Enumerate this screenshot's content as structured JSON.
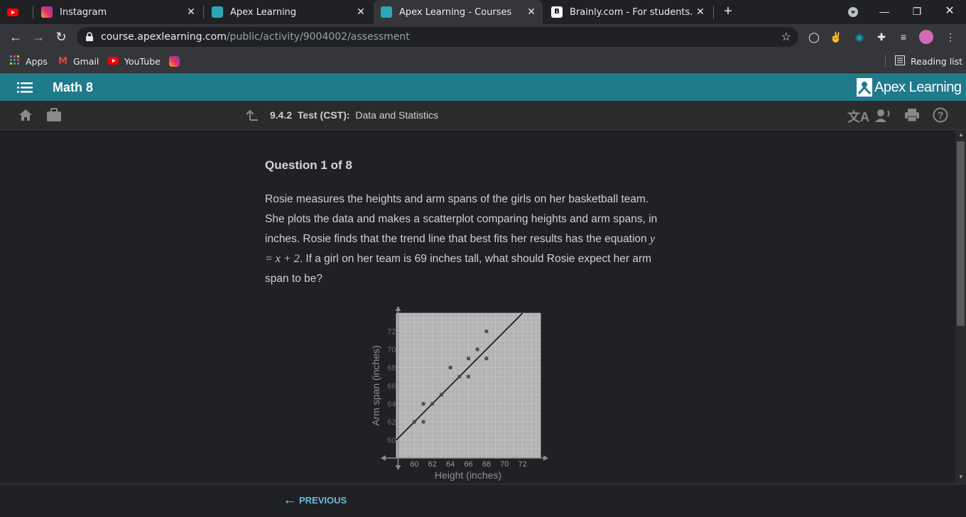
{
  "browser": {
    "tabs": [
      {
        "label": "",
        "favicon": "youtube-icon",
        "color": "#ff0000"
      },
      {
        "label": "Instagram",
        "favicon": "instagram-icon",
        "color": "#e1306c"
      },
      {
        "label": "Apex Learning",
        "favicon": "apex-learning-icon",
        "color": "#2aa6b8"
      },
      {
        "label": "Apex Learning - Courses",
        "favicon": "apex-learning-icon",
        "color": "#2aa6b8"
      },
      {
        "label": "Brainly.com - For students. By stu",
        "favicon": "brainly-icon",
        "color": "#ffffff"
      }
    ],
    "url_host": "course.apexlearning.com",
    "url_path": "/public/activity/9004002/assessment",
    "bookmarks": [
      {
        "label": "Apps",
        "icon": "apps-grid-icon"
      },
      {
        "label": "Gmail",
        "icon": "gmail-icon"
      },
      {
        "label": "YouTube",
        "icon": "youtube-icon"
      },
      {
        "label": "",
        "icon": "instagram-icon"
      }
    ],
    "reading_list": "Reading list"
  },
  "apex": {
    "course_title": "Math 8",
    "brand": "Apex Learning",
    "brand_color": "#1f7a8c",
    "activity_number": "9.4.2",
    "activity_type": "Test (CST):",
    "activity_title": "Data and Statistics"
  },
  "question": {
    "title": "Question 1 of 8",
    "text_part1": "Rosie measures the heights and arm spans of the girls on her basketball team. She plots the data and makes a scatterplot comparing heights and arm spans, in inches. Rosie finds that the trend line that best fits her results has the equation ",
    "equation": "y = x + 2",
    "text_part2": ". If a girl on her team is 69 inches tall, what should Rosie expect her arm span to be?"
  },
  "footer": {
    "previous_label": "PREVIOUS"
  },
  "chart_data": {
    "type": "scatter",
    "xlabel": "Height (inches)",
    "ylabel": "Arm span (inches)",
    "xlim": [
      58,
      74
    ],
    "ylim": [
      58,
      74
    ],
    "xticks": [
      60,
      62,
      64,
      66,
      68,
      70,
      72
    ],
    "yticks": [
      60,
      62,
      64,
      66,
      68,
      70,
      72
    ],
    "grid": true,
    "points": [
      {
        "x": 60,
        "y": 62
      },
      {
        "x": 61,
        "y": 62
      },
      {
        "x": 61,
        "y": 64
      },
      {
        "x": 62,
        "y": 64
      },
      {
        "x": 63,
        "y": 65
      },
      {
        "x": 64,
        "y": 68
      },
      {
        "x": 65,
        "y": 67
      },
      {
        "x": 66,
        "y": 67
      },
      {
        "x": 66,
        "y": 69
      },
      {
        "x": 67,
        "y": 70
      },
      {
        "x": 68,
        "y": 72
      },
      {
        "x": 68,
        "y": 69
      }
    ],
    "trend_line": {
      "slope": 1,
      "intercept": 2
    }
  }
}
